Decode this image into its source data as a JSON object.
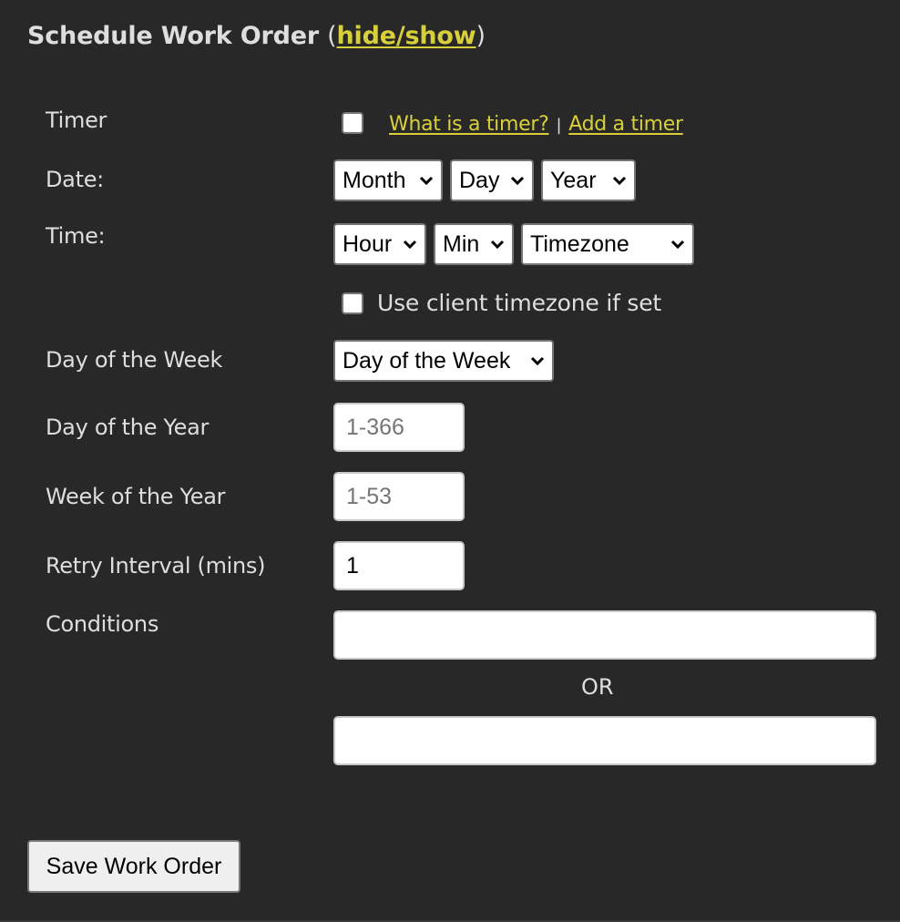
{
  "section": {
    "title": "Schedule Work Order",
    "paren_open": "(",
    "toggle_link": "hide/show",
    "paren_close": ")"
  },
  "colors": {
    "background": "#282828",
    "text": "#dedede",
    "link": "#d8cf3a"
  },
  "timer": {
    "label": "Timer",
    "checked": false,
    "what_link": "What is a timer?",
    "separator": "|",
    "add_link": "Add a timer"
  },
  "date": {
    "label": "Date:",
    "month": "Month",
    "day": "Day",
    "year": "Year"
  },
  "time": {
    "label": "Time:",
    "hour": "Hour",
    "min": "Min",
    "timezone": "Timezone",
    "client_tz_label": "Use client timezone if set",
    "client_tz_checked": false
  },
  "day_of_week": {
    "label": "Day of the Week",
    "selected": "Day of the Week"
  },
  "day_of_year": {
    "label": "Day of the Year",
    "value": "",
    "placeholder": "1-366"
  },
  "week_of_year": {
    "label": "Week of the Year",
    "value": "",
    "placeholder": "1-53"
  },
  "retry_interval": {
    "label": "Retry Interval (mins)",
    "value": "1"
  },
  "conditions": {
    "label": "Conditions",
    "value_1": "",
    "or_label": "OR",
    "value_2": ""
  },
  "save_button": "Save Work Order"
}
